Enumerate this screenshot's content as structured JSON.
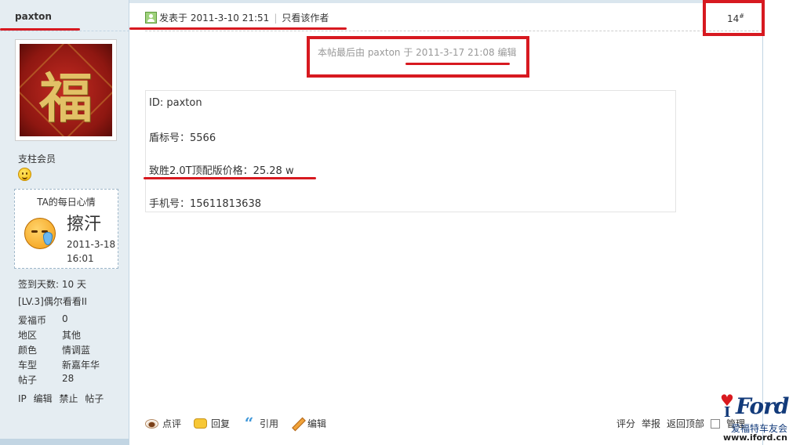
{
  "author": {
    "name": "paxton",
    "avatar_char": "福",
    "level": "支柱会员"
  },
  "mood": {
    "title": "TA的每日心情",
    "word": "擦汗",
    "time": "2011-3-18 16:01"
  },
  "stats": {
    "signin": "签到天数: 10 天",
    "rank": "[LV.3]偶尔看看II",
    "rows": [
      {
        "k": "爱福币",
        "v": "0"
      },
      {
        "k": "地区",
        "v": "其他"
      },
      {
        "k": "颜色",
        "v": "情调蓝"
      },
      {
        "k": "车型",
        "v": "新嘉年华"
      },
      {
        "k": "帖子",
        "v": "28"
      }
    ]
  },
  "admin_links": [
    "IP",
    "编辑",
    "禁止",
    "帖子"
  ],
  "post": {
    "posted_at": "发表于 2011-3-10 21:51",
    "only_author": "只看该作者",
    "floor": "14",
    "floor_mark": "#",
    "edit_note": "本帖最后由 paxton 于 2011-3-17 21:08 编辑",
    "lines": [
      "ID: paxton",
      "盾标号：5566",
      "致胜2.0T顶配版价格：25.28 w",
      "手机号：15611813638"
    ]
  },
  "actions": {
    "rate": "点评",
    "reply": "回复",
    "quote": "引用",
    "edit": "编辑"
  },
  "right_actions": {
    "score": "评分",
    "report": "举报",
    "top": "返回顶部",
    "manage": "管理"
  },
  "watermark": {
    "brand": "Ford",
    "letter": "I",
    "cn": "爱福特车友会",
    "url": "www.iford.cn"
  },
  "colors": {
    "annotation": "#d71920",
    "sidebar_bg": "#e5edf2",
    "border": "#c2d5e3"
  }
}
